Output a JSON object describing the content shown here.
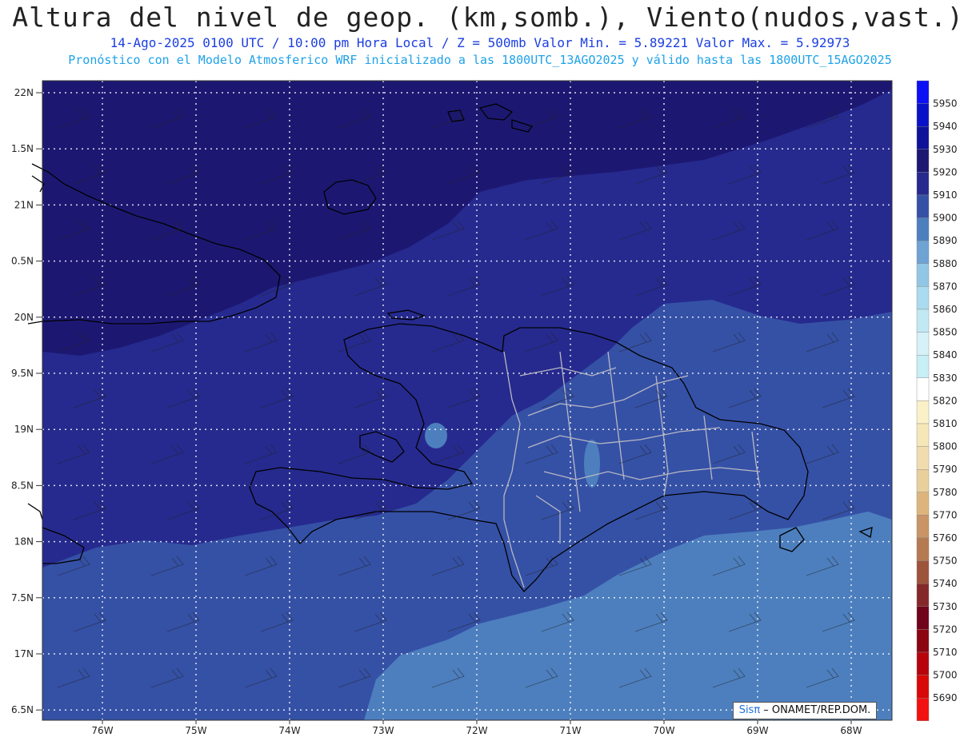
{
  "header": {
    "title": "Altura del nivel de geop. (km,somb.), Viento(nudos,vast.)",
    "subtitle": "14-Ago-2025  0100 UTC / 10:00 pm Hora Local / Z = 500mb    Valor Min. = 5.89221  Valor Max. = 5.92973",
    "description": "Pronóstico con el Modelo Atmosferico WRF inicializado a las 1800UTC_13AGO2025 y válido hasta las  1800UTC_15AGO2025"
  },
  "map": {
    "lat_labels": [
      "22N",
      "1.5N",
      "21N",
      "0.5N",
      "20N",
      "9.5N",
      "19N",
      "8.5N",
      "18N",
      "7.5N",
      "17N",
      "6.5N"
    ],
    "lon_labels": [
      "76W",
      "75W",
      "74W",
      "73W",
      "72W",
      "71W",
      "70W",
      "69W",
      "68W"
    ]
  },
  "legend": {
    "levels": [
      {
        "label": "5950",
        "color": "#0b10f5"
      },
      {
        "label": "5940",
        "color": "#0a12c8"
      },
      {
        "label": "5930",
        "color": "#0d1299"
      },
      {
        "label": "5920",
        "color": "#1c1872"
      },
      {
        "label": "5910",
        "color": "#262a8e"
      },
      {
        "label": "5900",
        "color": "#3551a6"
      },
      {
        "label": "5890",
        "color": "#4d7fbe"
      },
      {
        "label": "5880",
        "color": "#6ea3d4"
      },
      {
        "label": "5870",
        "color": "#91c7e4"
      },
      {
        "label": "5860",
        "color": "#aadbee"
      },
      {
        "label": "5850",
        "color": "#c1e9f3"
      },
      {
        "label": "5840",
        "color": "#d6f1f7"
      },
      {
        "label": "5830",
        "color": "#c8eef6"
      },
      {
        "label": "5820",
        "color": "#ffffff"
      },
      {
        "label": "5810",
        "color": "#fbf1c8"
      },
      {
        "label": "5800",
        "color": "#f6e7b9"
      },
      {
        "label": "5790",
        "color": "#f0dcae"
      },
      {
        "label": "5780",
        "color": "#e9cf9b"
      },
      {
        "label": "5770",
        "color": "#ddb57c"
      },
      {
        "label": "5760",
        "color": "#c99566"
      },
      {
        "label": "5750",
        "color": "#b67a52"
      },
      {
        "label": "5740",
        "color": "#9e543b"
      },
      {
        "label": "5730",
        "color": "#852829"
      },
      {
        "label": "5720",
        "color": "#70041b"
      },
      {
        "label": "5710",
        "color": "#8b0512"
      },
      {
        "label": "5700",
        "color": "#b7030c"
      },
      {
        "label": "5690",
        "color": "#d80808"
      },
      {
        "label": "",
        "color": "#f21010"
      }
    ]
  },
  "credit": {
    "sis": "Sisπ",
    "text": " – ONAMET/REP.DOM."
  }
}
